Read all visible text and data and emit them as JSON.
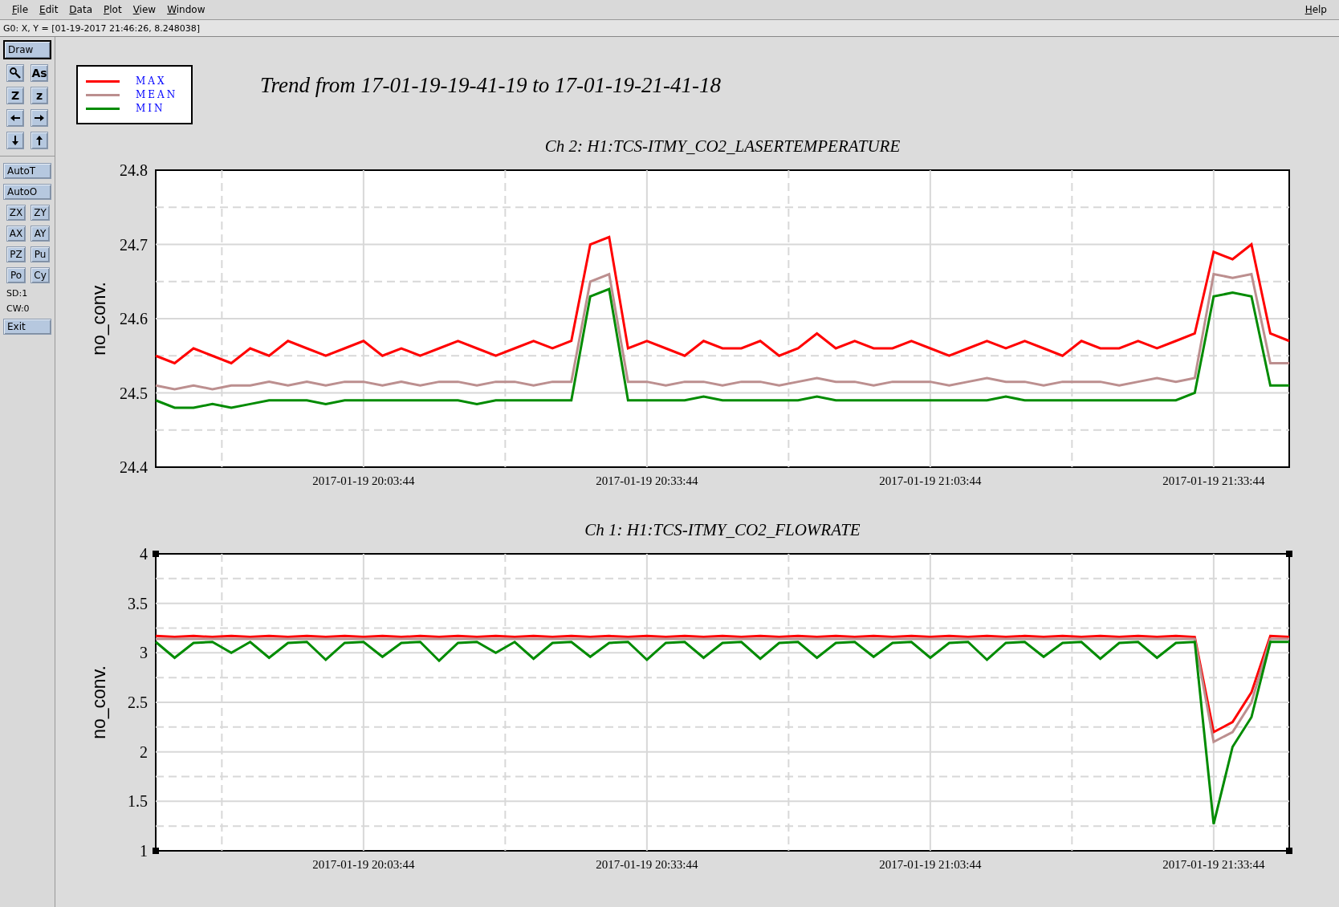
{
  "menu": [
    {
      "label": "File"
    },
    {
      "label": "Edit"
    },
    {
      "label": "Data"
    },
    {
      "label": "Plot"
    },
    {
      "label": "View"
    },
    {
      "label": "Window"
    }
  ],
  "help_menu": {
    "label": "Help"
  },
  "status_line": "G0: X, Y = [01-19-2017 21:46:26, 8.248038]",
  "toolbar": {
    "draw_button": {
      "label": "Draw",
      "selected": true
    },
    "tools": [
      {
        "kind": "magnifier"
      },
      {
        "kind": "text",
        "label": "As"
      },
      {
        "kind": "text",
        "label": "Z"
      },
      {
        "kind": "text",
        "label": "z"
      },
      {
        "kind": "left"
      },
      {
        "kind": "right"
      },
      {
        "kind": "down"
      },
      {
        "kind": "up"
      }
    ],
    "wide_buttons": [
      {
        "label": "AutoT"
      },
      {
        "label": "AutoO"
      }
    ],
    "small_buttons": [
      {
        "label": "ZX"
      },
      {
        "label": "ZY"
      },
      {
        "label": "AX"
      },
      {
        "label": "AY"
      },
      {
        "label": "PZ"
      },
      {
        "label": "Pu"
      },
      {
        "label": "Po"
      },
      {
        "label": "Cy"
      }
    ],
    "readouts": [
      "SD:1",
      "CW:0"
    ],
    "exit_button": {
      "label": "Exit"
    }
  },
  "page_title": "Trend from 17-01-19-19-41-19 to 17-01-19-21-41-18",
  "charts": [
    {
      "selected": false,
      "chart_data": {
        "type": "line",
        "title": "Ch 2: H1:TCS-ITMY_CO2_LASERTEMPERATURE",
        "ylabel": "no_conv.",
        "categories": [
          null,
          null,
          null,
          null,
          null,
          null,
          null,
          null,
          null,
          null,
          null,
          "2017-01-19 20:03:44",
          null,
          null,
          null,
          null,
          null,
          null,
          null,
          null,
          null,
          null,
          null,
          null,
          null,
          null,
          "2017-01-19 20:33:44",
          null,
          null,
          null,
          null,
          null,
          null,
          null,
          null,
          null,
          null,
          null,
          null,
          null,
          null,
          "2017-01-19 21:03:44",
          null,
          null,
          null,
          null,
          null,
          null,
          null,
          null,
          null,
          null,
          null,
          null,
          null,
          null,
          "2017-01-19 21:33:44",
          null,
          null,
          null,
          null
        ],
        "ylim": [
          24.4,
          24.8
        ],
        "grid": true,
        "yticks": [
          24.4,
          24.5,
          24.6,
          24.7,
          24.8
        ],
        "series": [
          {
            "name": "MAX",
            "color": "#ff0000",
            "values": [
              24.55,
              24.54,
              24.56,
              24.55,
              24.54,
              24.56,
              24.55,
              24.57,
              24.56,
              24.55,
              24.56,
              24.57,
              24.55,
              24.56,
              24.55,
              24.56,
              24.57,
              24.56,
              24.55,
              24.56,
              24.57,
              24.56,
              24.57,
              24.7,
              24.71,
              24.56,
              24.57,
              24.56,
              24.55,
              24.57,
              24.56,
              24.56,
              24.57,
              24.55,
              24.56,
              24.58,
              24.56,
              24.57,
              24.56,
              24.56,
              24.57,
              24.56,
              24.55,
              24.56,
              24.57,
              24.56,
              24.57,
              24.56,
              24.55,
              24.57,
              24.56,
              24.56,
              24.57,
              24.56,
              24.57,
              24.58,
              24.69,
              24.68,
              24.7,
              24.58,
              24.57
            ]
          },
          {
            "name": "MEAN",
            "color": "#bc8f8f",
            "values": [
              24.51,
              24.505,
              24.51,
              24.505,
              24.51,
              24.51,
              24.515,
              24.51,
              24.515,
              24.51,
              24.515,
              24.515,
              24.51,
              24.515,
              24.51,
              24.515,
              24.515,
              24.51,
              24.515,
              24.515,
              24.51,
              24.515,
              24.515,
              24.65,
              24.66,
              24.515,
              24.515,
              24.51,
              24.515,
              24.515,
              24.51,
              24.515,
              24.515,
              24.51,
              24.515,
              24.52,
              24.515,
              24.515,
              24.51,
              24.515,
              24.515,
              24.515,
              24.51,
              24.515,
              24.52,
              24.515,
              24.515,
              24.51,
              24.515,
              24.515,
              24.515,
              24.51,
              24.515,
              24.52,
              24.515,
              24.52,
              24.66,
              24.655,
              24.66,
              24.54,
              24.54
            ]
          },
          {
            "name": "MIN",
            "color": "#008b00",
            "values": [
              24.49,
              24.48,
              24.48,
              24.485,
              24.48,
              24.485,
              24.49,
              24.49,
              24.49,
              24.485,
              24.49,
              24.49,
              24.49,
              24.49,
              24.49,
              24.49,
              24.49,
              24.485,
              24.49,
              24.49,
              24.49,
              24.49,
              24.49,
              24.63,
              24.64,
              24.49,
              24.49,
              24.49,
              24.49,
              24.495,
              24.49,
              24.49,
              24.49,
              24.49,
              24.49,
              24.495,
              24.49,
              24.49,
              24.49,
              24.49,
              24.49,
              24.49,
              24.49,
              24.49,
              24.49,
              24.495,
              24.49,
              24.49,
              24.49,
              24.49,
              24.49,
              24.49,
              24.49,
              24.49,
              24.49,
              24.5,
              24.63,
              24.635,
              24.63,
              24.51,
              24.51
            ]
          }
        ]
      }
    },
    {
      "selected": true,
      "chart_data": {
        "type": "line",
        "title": "Ch 1: H1:TCS-ITMY_CO2_FLOWRATE",
        "ylabel": "no_conv.",
        "categories": [
          null,
          null,
          null,
          null,
          null,
          null,
          null,
          null,
          null,
          null,
          null,
          "2017-01-19 20:03:44",
          null,
          null,
          null,
          null,
          null,
          null,
          null,
          null,
          null,
          null,
          null,
          null,
          null,
          null,
          "2017-01-19 20:33:44",
          null,
          null,
          null,
          null,
          null,
          null,
          null,
          null,
          null,
          null,
          null,
          null,
          null,
          null,
          "2017-01-19 21:03:44",
          null,
          null,
          null,
          null,
          null,
          null,
          null,
          null,
          null,
          null,
          null,
          null,
          null,
          null,
          "2017-01-19 21:33:44",
          null,
          null,
          null,
          null
        ],
        "ylim": [
          1,
          4
        ],
        "grid": true,
        "yticks": [
          1,
          1.5,
          2,
          2.5,
          3,
          3.5,
          4
        ],
        "series": [
          {
            "color": "#ff0000",
            "values": [
              3.17,
              3.16,
              3.17,
              3.16,
              3.17,
              3.16,
              3.17,
              3.16,
              3.17,
              3.16,
              3.17,
              3.16,
              3.17,
              3.16,
              3.17,
              3.16,
              3.17,
              3.16,
              3.17,
              3.16,
              3.17,
              3.16,
              3.17,
              3.16,
              3.17,
              3.16,
              3.17,
              3.16,
              3.17,
              3.16,
              3.17,
              3.16,
              3.17,
              3.16,
              3.17,
              3.16,
              3.17,
              3.16,
              3.17,
              3.16,
              3.17,
              3.16,
              3.17,
              3.16,
              3.17,
              3.16,
              3.17,
              3.16,
              3.17,
              3.16,
              3.17,
              3.16,
              3.17,
              3.16,
              3.17,
              3.16,
              2.2,
              2.3,
              2.6,
              3.17,
              3.16
            ]
          },
          {
            "color": "#bc8f8f",
            "values": [
              3.14,
              3.14,
              3.14,
              3.14,
              3.14,
              3.14,
              3.14,
              3.14,
              3.14,
              3.14,
              3.14,
              3.14,
              3.14,
              3.14,
              3.14,
              3.14,
              3.14,
              3.14,
              3.14,
              3.14,
              3.14,
              3.14,
              3.14,
              3.14,
              3.14,
              3.14,
              3.14,
              3.14,
              3.14,
              3.14,
              3.14,
              3.14,
              3.14,
              3.14,
              3.14,
              3.14,
              3.14,
              3.14,
              3.14,
              3.14,
              3.14,
              3.14,
              3.14,
              3.14,
              3.14,
              3.14,
              3.14,
              3.14,
              3.14,
              3.14,
              3.14,
              3.14,
              3.14,
              3.14,
              3.14,
              3.14,
              2.1,
              2.2,
              2.5,
              3.14,
              3.14
            ]
          },
          {
            "color": "#008b00",
            "values": [
              3.11,
              2.95,
              3.1,
              3.11,
              3.0,
              3.11,
              2.95,
              3.1,
              3.11,
              2.93,
              3.1,
              3.11,
              2.96,
              3.1,
              3.11,
              2.92,
              3.1,
              3.11,
              3.0,
              3.11,
              2.94,
              3.1,
              3.11,
              2.96,
              3.1,
              3.11,
              2.93,
              3.1,
              3.11,
              2.95,
              3.1,
              3.11,
              2.94,
              3.1,
              3.11,
              2.95,
              3.1,
              3.11,
              2.96,
              3.1,
              3.11,
              2.95,
              3.1,
              3.11,
              2.93,
              3.1,
              3.11,
              2.96,
              3.1,
              3.11,
              2.94,
              3.1,
              3.11,
              2.95,
              3.1,
              3.11,
              1.27,
              2.05,
              2.35,
              3.11,
              3.11
            ]
          }
        ]
      }
    }
  ]
}
